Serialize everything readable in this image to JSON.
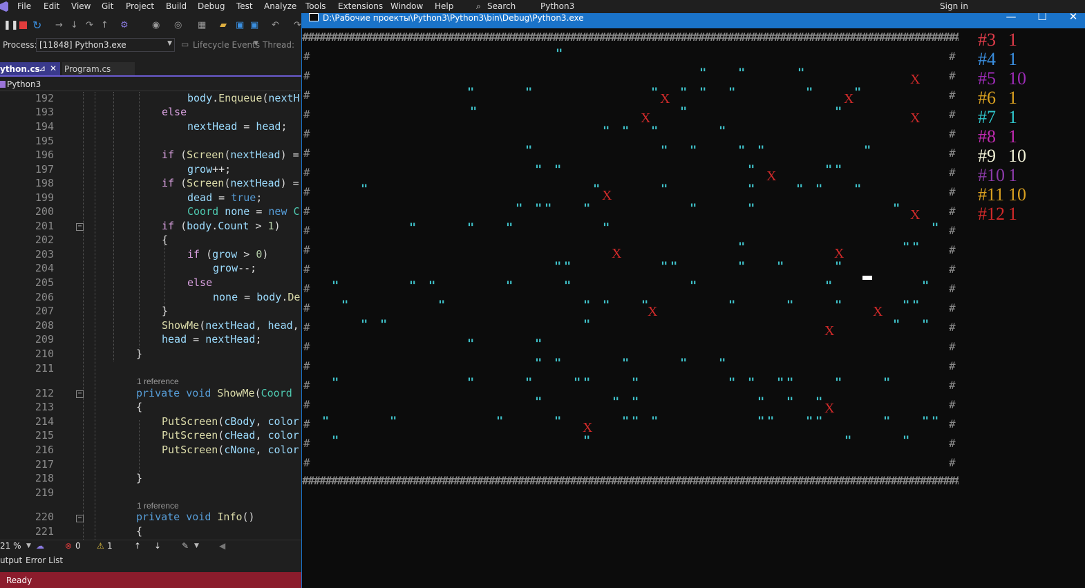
{
  "menu": [
    "File",
    "Edit",
    "View",
    "Git",
    "Project",
    "Build",
    "Debug",
    "Test",
    "Analyze",
    "Tools",
    "Extensions",
    "Window",
    "Help"
  ],
  "menu_search": "Search",
  "menu_solution": "Python3",
  "menu_signin": "Sign in",
  "toolbar": {
    "lifecycle": "Lifecycle Events",
    "thread_label": "Thread:"
  },
  "process": {
    "label": "Process:",
    "value": "[11848] Python3.exe"
  },
  "tabs": {
    "active": "ython.cs",
    "other": "Program.cs"
  },
  "navbar": {
    "scope": "Python3"
  },
  "code": {
    "line_numbers": [
      "192",
      "193",
      "194",
      "195",
      "196",
      "197",
      "198",
      "199",
      "200",
      "201",
      "202",
      "203",
      "204",
      "205",
      "206",
      "207",
      "208",
      "209",
      "210",
      "211",
      "212",
      "213",
      "214",
      "215",
      "216",
      "217",
      "218",
      "219",
      "220",
      "221"
    ],
    "reference_label": "1 reference"
  },
  "status": {
    "zoom": "21 %",
    "errors": "0",
    "warnings": "1"
  },
  "panel_tabs": [
    "utput",
    "Error List"
  ],
  "statusbar": {
    "text": "Ready"
  },
  "console": {
    "title": "D:\\Рабочие проекты\\Python3\\Python3\\bin\\Debug\\Python3.exe",
    "colors": {
      "food": "#3fc1c9",
      "obstacle": "#d12a2a",
      "border": "#8a8a8a",
      "snake": "#ffffff"
    },
    "food_glyph": "\"",
    "obstacle_glyph": "X",
    "border_glyph": "#",
    "scores": [
      {
        "id": "#3",
        "value": "1",
        "color": "#e03c4a"
      },
      {
        "id": "#4",
        "value": "1",
        "color": "#3a8fe0"
      },
      {
        "id": "#5",
        "value": "10",
        "color": "#9b2bb5"
      },
      {
        "id": "#6",
        "value": "1",
        "color": "#d9a020"
      },
      {
        "id": "#7",
        "value": "1",
        "color": "#2fc4c9"
      },
      {
        "id": "#8",
        "value": "1",
        "color": "#c02ab0"
      },
      {
        "id": "#9",
        "value": "10",
        "color": "#f3f3d8"
      },
      {
        "id": "#10",
        "value": "1",
        "color": "#8b3aa8"
      },
      {
        "id": "#11",
        "value": "10",
        "color": "#d9a020"
      },
      {
        "id": "#12",
        "value": "1",
        "color": "#d02a2a"
      }
    ]
  }
}
